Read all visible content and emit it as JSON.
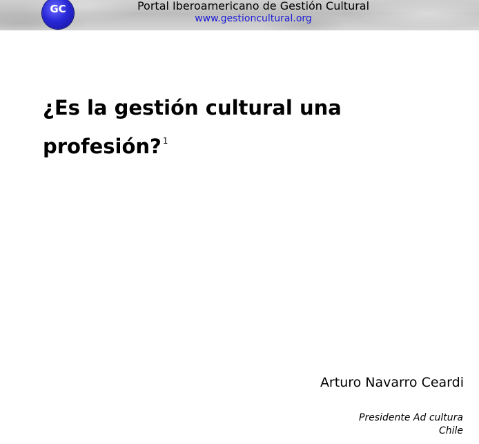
{
  "header": {
    "logo_text": "GC",
    "portal_title": "Portal Iberoamericano de Gestión Cultural",
    "portal_url": "www.gestioncultural.org"
  },
  "document": {
    "title_line1": "¿Es la gestión cultural una",
    "title_line2": "profesión?",
    "footnote_marker": "1",
    "author": "Arturo Navarro Ceardi",
    "affiliation_role": "Presidente Ad cultura",
    "affiliation_country": "Chile"
  },
  "colors": {
    "header_bg": "#c8c8c8",
    "logo_blue": "#2a2ad8",
    "link_blue": "#1a1ad6",
    "text": "#000000"
  }
}
